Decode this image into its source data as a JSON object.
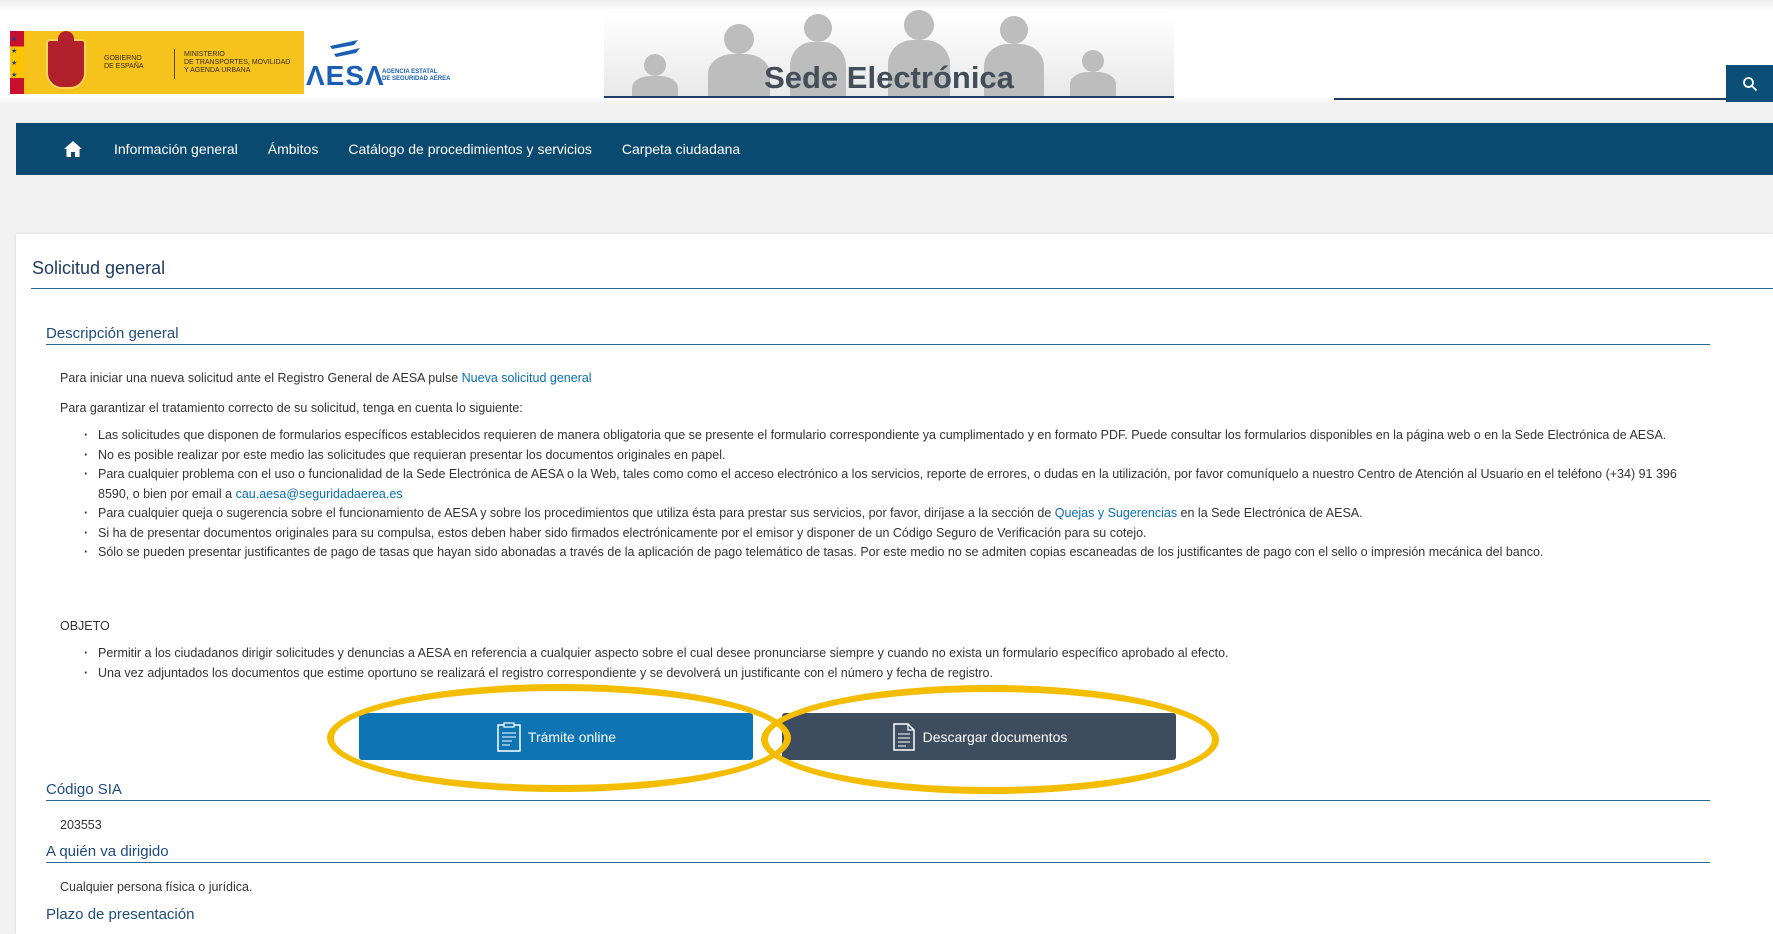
{
  "header": {
    "gov_text": "GOBIERNO\nDE ESPAÑA",
    "ministry_text": "MINISTERIO\nDE TRANSPORTES, MOVILIDAD\nY AGENDA URBANA",
    "aesa_word": "ΛESΛ",
    "aesa_agency": "AGENCIA ESTATAL\nDE SEGURIDAD AÉREA",
    "banner_title": "Sede Electrónica",
    "search_value": ""
  },
  "nav": {
    "items": [
      "Información general",
      "Ámbitos",
      "Catálogo de procedimientos y servicios",
      "Carpeta ciudadana"
    ]
  },
  "page": {
    "title": "Solicitud general",
    "desc_heading": "Descripción general",
    "intro": {
      "text": "Para iniciar una nueva solicitud ante el Registro General de AESA pulse ",
      "link": "Nueva solicitud general"
    },
    "intro2": "Para garantizar el tratamiento correcto de su solicitud, tenga en cuenta lo siguiente:",
    "bullets": [
      {
        "pre": "Las solicitudes que disponen de formularios específicos establecidos requieren de manera obligatoria que se presente el formulario correspondiente ya cumplimentado y en formato PDF. Puede consultar los formularios disponibles en la página web o en la Sede Electrónica de AESA.",
        "link": "",
        "post": ""
      },
      {
        "pre": "No es posible realizar por este medio las solicitudes que requieran presentar los documentos originales en papel.",
        "link": "",
        "post": ""
      },
      {
        "pre": "Para cualquier problema con el uso o funcionalidad de la Sede Electrónica de AESA o la Web, tales como como el acceso electrónico a los servicios, reporte de errores, o dudas en la utilización, por favor comuníquelo a nuestro Centro de Atención al Usuario en el teléfono (+34) 91 396 8590, o bien por email a ",
        "link": "cau.aesa@seguridadaerea.es",
        "post": ""
      },
      {
        "pre": "Para cualquier queja o sugerencia sobre el funcionamiento de AESA y sobre los procedimientos que utiliza ésta para prestar sus servicios, por favor, diríjase a la sección de ",
        "link": "Quejas y Sugerencias",
        "post": " en la Sede Electrónica de AESA."
      },
      {
        "pre": "Si ha de presentar documentos originales para su compulsa, estos deben haber sido firmados electrónicamente por el emisor y disponer de un Código Seguro de Verificación para su cotejo.",
        "link": "",
        "post": ""
      },
      {
        "pre": "Sólo se pueden presentar justificantes de pago de tasas que hayan sido abonadas a través de la aplicación de pago telemático de tasas. Por este medio no se admiten copias escaneadas de los justificantes de pago con el sello o impresión mecánica del banco.",
        "link": "",
        "post": ""
      }
    ],
    "objeto_label": "OBJETO",
    "objeto_bullets": [
      "Permitir a los ciudadanos dirigir solicitudes y denuncias a AESA en referencia a cualquier aspecto sobre el cual desee pronunciarse siempre y cuando no exista un formulario específico aprobado al efecto.",
      "Una vez adjuntados los documentos que estime oportuno se realizará el registro correspondiente y se devolverá un justificante con el número y fecha de registro."
    ],
    "buttons": {
      "online": "Trámite online",
      "docs": "Descargar documentos"
    },
    "sia_heading": "Código SIA",
    "sia_value": "203553",
    "target_heading": "A quién va dirigido",
    "target_value": "Cualquier persona física o jurídica.",
    "deadline_heading": "Plazo de presentación"
  },
  "colors": {
    "nav_bg": "#0b4a70",
    "primary_button": "#0f74b3",
    "secondary_button": "#3d4d5f",
    "highlight": "#f5bd00",
    "link": "#0a6fb0"
  }
}
